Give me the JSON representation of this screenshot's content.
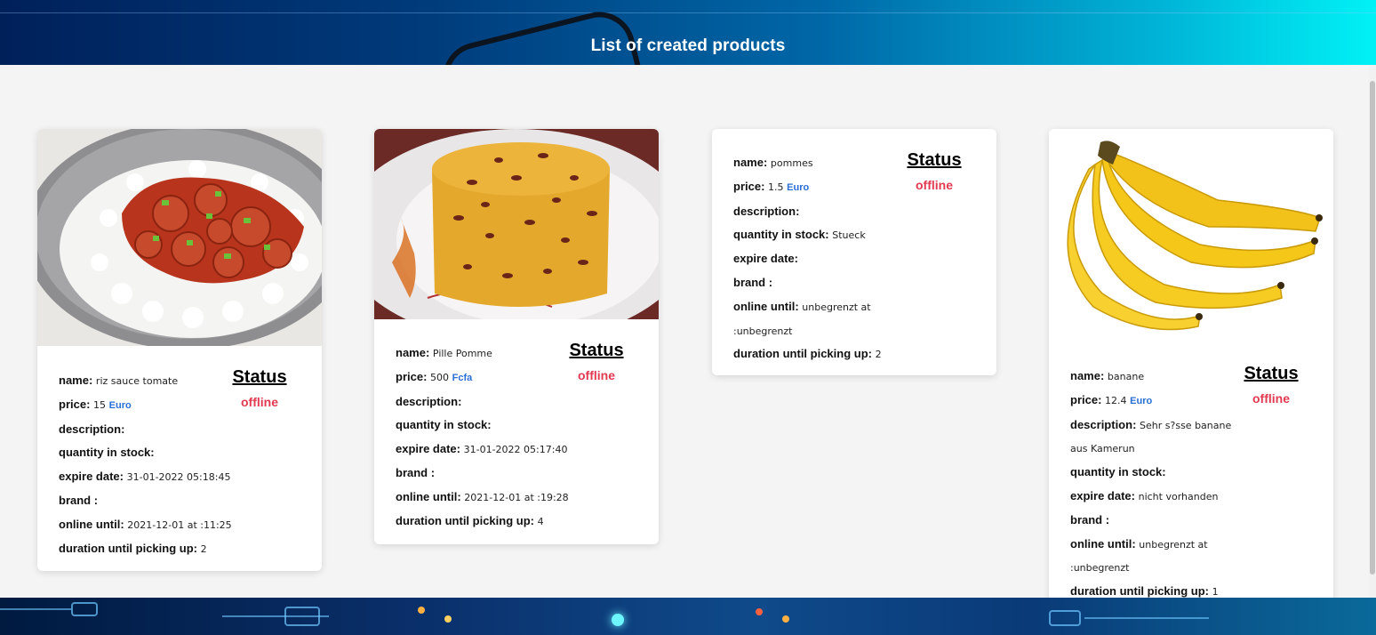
{
  "header": {
    "title": "List of created products"
  },
  "labels": {
    "name": "name:",
    "price": "price:",
    "description": "description:",
    "quantity": "quantity in stock:",
    "expire": "expire date:",
    "brand": "brand :",
    "online": "online until:",
    "duration": "duration until picking up:",
    "status_title": "Status"
  },
  "products": [
    {
      "image": "rice-with-tomato-sauce-and-sausage",
      "name": "riz sauce tomate",
      "price": "15",
      "currency": "Euro",
      "description": "",
      "quantity": "",
      "expire": "31-01-2022 05:18:45",
      "brand": "",
      "online_until": "2021-12-01 at :11:25",
      "duration": "2",
      "status": "offline"
    },
    {
      "image": "yellow-cake-with-beans",
      "name": "Pille Pomme",
      "price": "500",
      "currency": "Fcfa",
      "description": "",
      "quantity": "",
      "expire": "31-01-2022 05:17:40",
      "brand": "",
      "online_until": "2021-12-01 at :19:28",
      "duration": "4",
      "status": "offline"
    },
    {
      "image": "",
      "name": "pommes",
      "price": "1.5",
      "currency": "Euro",
      "description": "",
      "quantity": "Stueck",
      "expire": "",
      "brand": "",
      "online_until_line1": "unbegrenzt at",
      "online_until_line2": ":unbegrenzt",
      "duration": "2",
      "status": "offline"
    },
    {
      "image": "bananas",
      "name": "banane",
      "price": "12.4",
      "currency": "Euro",
      "description_line1": "Sehr s?sse banane",
      "description_line2": "aus Kamerun",
      "quantity": "",
      "expire": "nicht vorhanden",
      "brand": "",
      "online_until_line1": "unbegrenzt at",
      "online_until_line2": ":unbegrenzt",
      "duration": "1",
      "status": "offline"
    }
  ]
}
